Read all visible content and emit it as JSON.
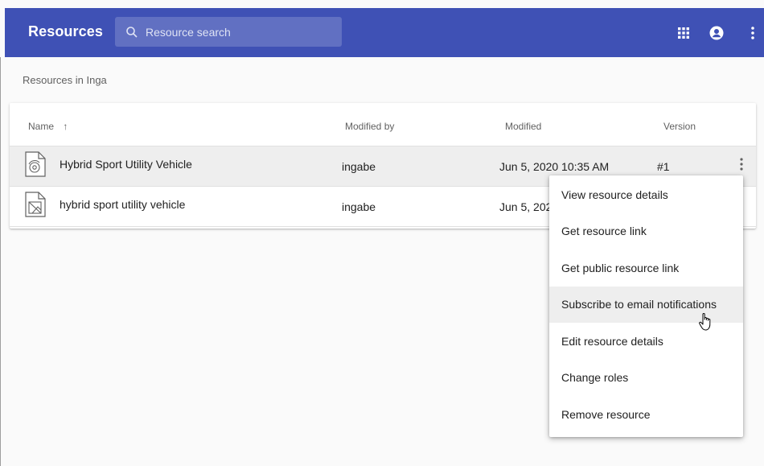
{
  "appbar": {
    "title": "Resources",
    "search_placeholder": "Resource search",
    "icons": [
      "apps-grid-icon",
      "account-circle-icon",
      "more-vert-icon"
    ],
    "color": "#3f51b5"
  },
  "breadcrumb": "Resources in Inga",
  "table": {
    "columns": {
      "name": "Name",
      "sort_indicator": "↑",
      "modified_by": "Modified by",
      "modified": "Modified",
      "version": "Version"
    },
    "rows": [
      {
        "name": "Hybrid Sport Utility Vehicle",
        "icon": "model-3d-file-icon",
        "modified_by": "ingabe",
        "modified": "Jun 5, 2020 10:35 AM",
        "version": "#1",
        "selected": true
      },
      {
        "name": "hybrid sport utility vehicle",
        "icon": "image-file-icon",
        "modified_by": "ingabe",
        "modified": "Jun 5, 202",
        "version": "",
        "selected": false
      }
    ]
  },
  "context_menu": {
    "items": [
      "View resource details",
      "Get resource link",
      "Get public resource link",
      "Subscribe to email notifications",
      "Edit resource details",
      "Change roles",
      "Remove resource"
    ],
    "hovered_index": 3
  }
}
